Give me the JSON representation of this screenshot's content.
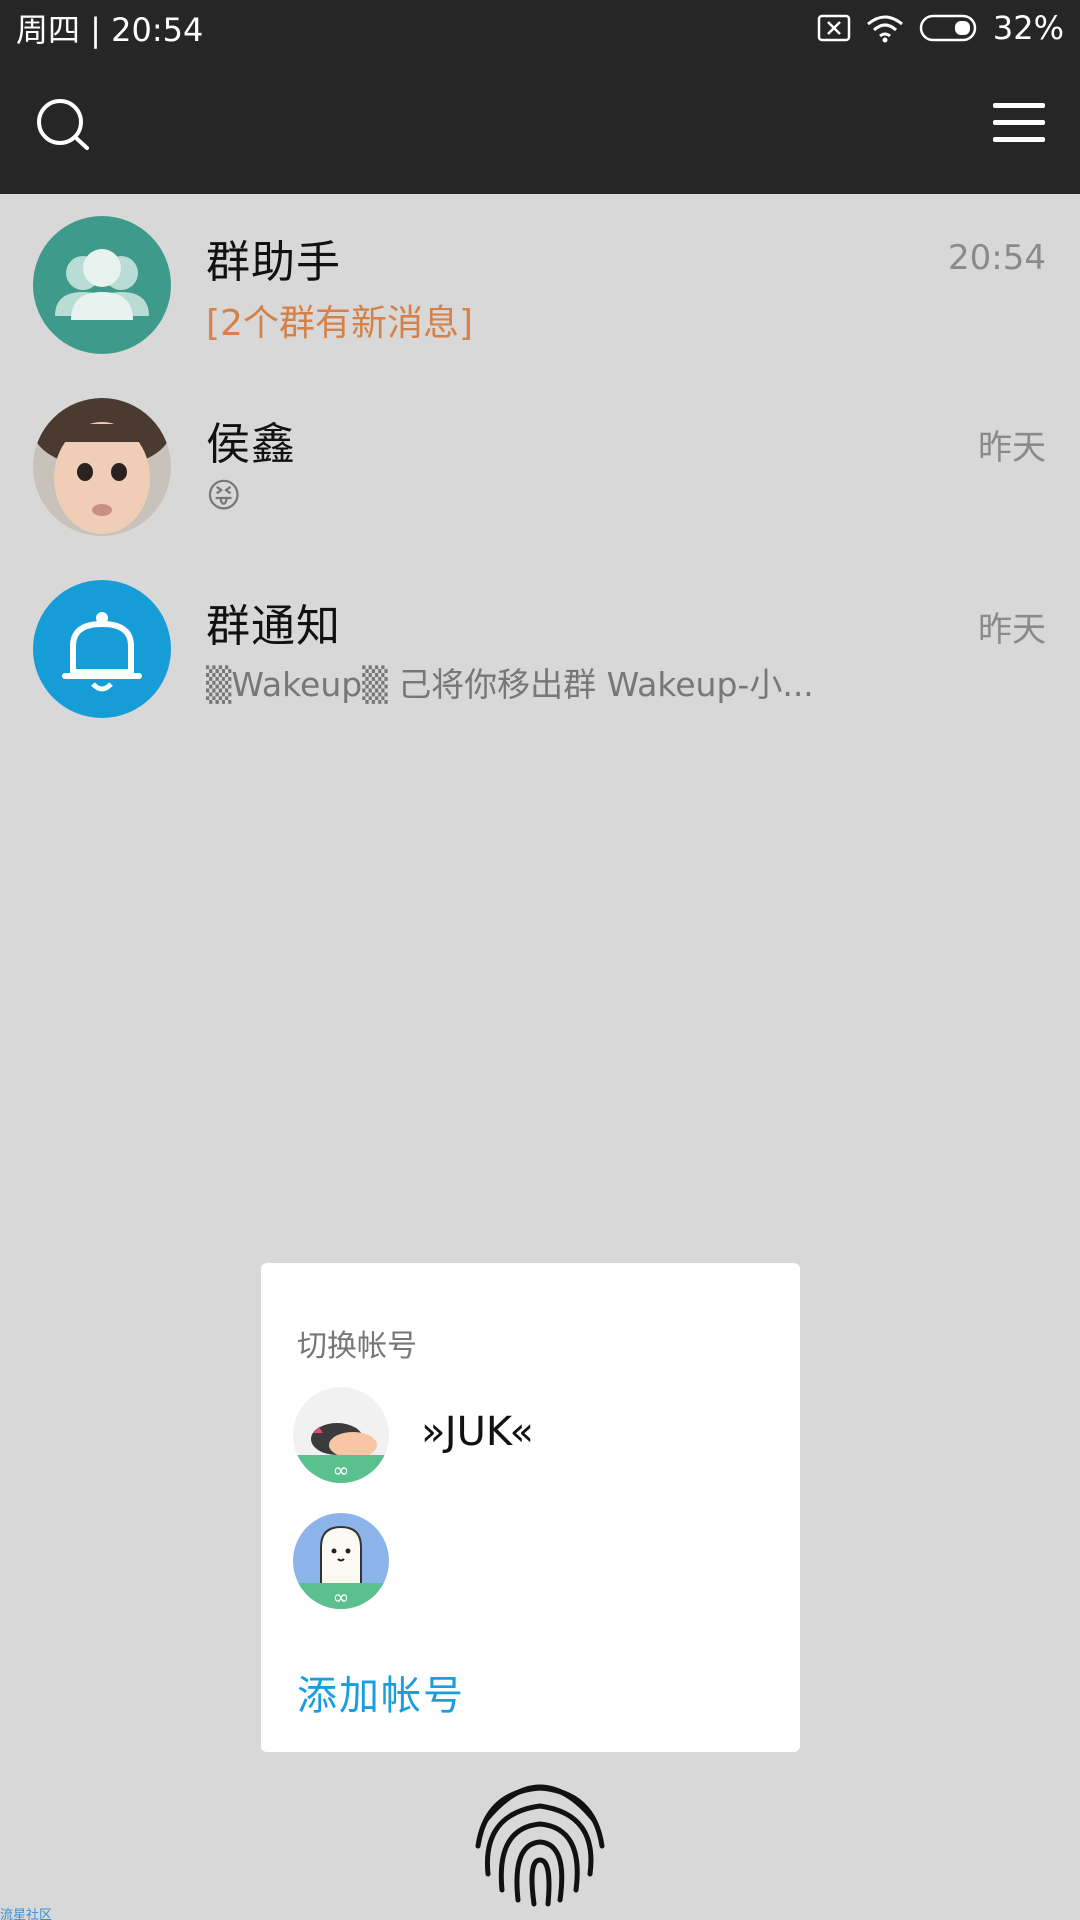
{
  "status_bar": {
    "datetime": "周四 | 20:54",
    "battery": "32%"
  },
  "header": {
    "search_icon": "search-icon",
    "menu_icon": "menu-icon"
  },
  "chats": [
    {
      "name": "群助手",
      "time": "20:54",
      "preview": "[2个群有新消息]",
      "avatar": "group-assistant-icon"
    },
    {
      "name": "侯鑫",
      "time": "昨天",
      "preview": "😝",
      "avatar": "photo-avatar"
    },
    {
      "name": "群通知",
      "time": "昨天",
      "preview": "▒Wakeup▒ 己将你移出群 Wakeup-小...",
      "avatar": "bell-icon"
    }
  ],
  "dialog": {
    "title": "切换帐号",
    "accounts": [
      {
        "name": "»JUK«"
      },
      {
        "name": ""
      }
    ],
    "add_account": "添加帐号"
  },
  "watermark": "流星社区",
  "colors": {
    "bar_bg": "#262626",
    "page_bg": "#d8d8d8",
    "group_assistant": "#3e9b8b",
    "notice_blue": "#169dd8",
    "accent_orange": "#d5824a",
    "link_blue": "#1a9ee0"
  }
}
